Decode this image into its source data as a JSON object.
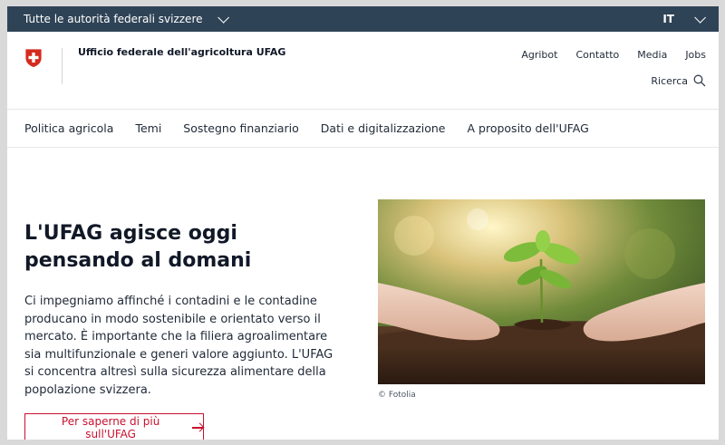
{
  "topbar": {
    "authorities_label": "Tutte le autorità federali svizzere",
    "language": "IT"
  },
  "header": {
    "office_name": "Ufficio federale dell'agricoltura UFAG",
    "service_links": [
      "Agribot",
      "Contatto",
      "Media",
      "Jobs"
    ],
    "search_label": "Ricerca"
  },
  "main_nav": [
    "Politica agricola",
    "Temi",
    "Sostegno finanziario",
    "Dati e digitalizzazione",
    "A proposito dell'UFAG"
  ],
  "hero": {
    "title": "L'UFAG agisce oggi pensando al domani",
    "text": "Ci impegniamo affinché i contadini e le contadine producano in modo sostenibile e orientato verso il mercato. È importante che la filiera agroalimentare sia multifunzionale e generi valore aggiunto. L'UFAG si concentra altresì sulla sicurezza alimentare della popolazione svizzera.",
    "cta_label": "Per saperne di più sull'UFAG",
    "image_credit": "© Fotolia"
  },
  "colors": {
    "topbar": "#2f4356",
    "accent_red": "#c8102e"
  }
}
